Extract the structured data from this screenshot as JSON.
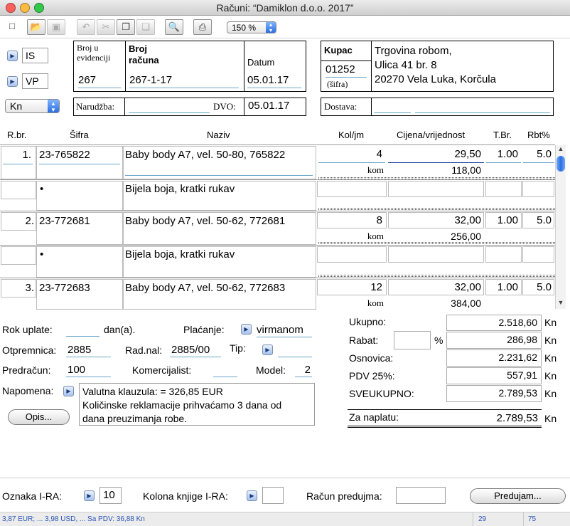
{
  "window": {
    "title": "Računi: “Damiklon d.o.o. 2017”"
  },
  "toolbar": {
    "icons": [
      "new-doc-icon",
      "open-icon",
      "save-icon",
      "undo-icon",
      "cut-icon",
      "copy-icon",
      "paste-icon",
      "preview-icon",
      "print-icon"
    ],
    "zoom": "150 %"
  },
  "doc": {
    "type1": "IS",
    "type2": "VP",
    "currency": "Kn",
    "broj_evidencija_label1": "Broj u",
    "broj_evidencija_label2": "evidenciji",
    "broj_evidencija": "267",
    "broj_racuna_label1": "Broj",
    "broj_racuna_label2": "računa",
    "broj_racuna": "267-1-17",
    "datum_label": "Datum",
    "datum": "05.01.17",
    "narudzba_label": "Narudžba:",
    "narudzba": "",
    "dvo_label": "DVO:",
    "dvo": "05.01.17"
  },
  "kupac": {
    "label": "Kupac",
    "code": "01252",
    "sifra_label": "(šifra)",
    "line1": "Trgovina robom,",
    "line2": "Ulica 41 br. 8",
    "line3": "20270 Vela Luka, Korčula",
    "dostava_label": "Dostava:"
  },
  "columns": [
    "R.br.",
    "Šifra",
    "Naziv",
    "Kol/jm",
    "Cijena/vrijednost",
    "T.Br.",
    "Rbt%"
  ],
  "items": [
    {
      "rbr": "1.",
      "sifra": "23-765822",
      "naziv": "Baby body A7, vel. 50-80, 765822",
      "kol": "4",
      "jm": "kom",
      "cijena": "29,50",
      "vrijednost": "118,00",
      "tbr": "1.00",
      "rbt": "5.0",
      "note": "Bijela boja, kratki rukav"
    },
    {
      "rbr": "2.",
      "sifra": "23-772681",
      "naziv": "Baby body A7, vel. 50-62, 772681",
      "kol": "8",
      "jm": "kom",
      "cijena": "32,00",
      "vrijednost": "256,00",
      "tbr": "1.00",
      "rbt": "5.0",
      "note": "Bijela boja, kratki rukav"
    },
    {
      "rbr": "3.",
      "sifra": "23-772683",
      "naziv": "Baby body A7, vel. 50-62, 772683",
      "kol": "12",
      "jm": "kom",
      "cijena": "32,00",
      "vrijednost": "384,00",
      "tbr": "1.00",
      "rbt": "5.0"
    }
  ],
  "bullet": "•",
  "footer": {
    "rok_label": "Rok uplate:",
    "rok_unit": "dan(a).",
    "placanje_label": "Plaćanje:",
    "placanje": "virmanom",
    "otpremnica_label": "Otpremnica:",
    "otpremnica": "2885",
    "radnal_label": "Rad.nal:",
    "radnal": "2885/00",
    "tip_label": "Tip:",
    "predracun_label": "Predračun:",
    "predracun": "100",
    "komercijalist_label": "Komercijalist:",
    "model_label": "Model:",
    "model": "2",
    "napomena_label": "Napomena:",
    "napomena1": "Valutna klauzula: =  326,85 EUR",
    "napomena2": "Količinske reklamacije prihvaćamo 3 dana od",
    "napomena3": "dana preuzimanja robe.",
    "opis_button": "Opis..."
  },
  "totals": {
    "ukupno_label": "Ukupno:",
    "ukupno": "2.518,60",
    "rabat_label": "Rabat:",
    "rabat_pct": "%",
    "rabat": "286,98",
    "osnovica_label": "Osnovica:",
    "osnovica": "2.231,62",
    "pdv_label": "PDV 25%:",
    "pdv": "557,91",
    "sveukupno_label": "SVEUKUPNO:",
    "sveukupno": "2.789,53",
    "zanaplatu_label": "Za naplatu:",
    "zanaplatu": "2.789,53",
    "kn": "Kn"
  },
  "bottom": {
    "oznaka_label": "Oznaka I-RA:",
    "oznaka": "10",
    "kolona_label": "Kolona knjige I-RA:",
    "predujma_label": "Račun predujma:",
    "predujam_button": "Predujam..."
  },
  "status": {
    "text": "3,87 EUR; ... 3,98 USD, ... Sa PDV: 36,88 Kn",
    "field1": "29",
    "field2": "75"
  },
  "colors": {
    "accent_blue": "#6aa6c9",
    "status_text": "#2a54b5"
  }
}
